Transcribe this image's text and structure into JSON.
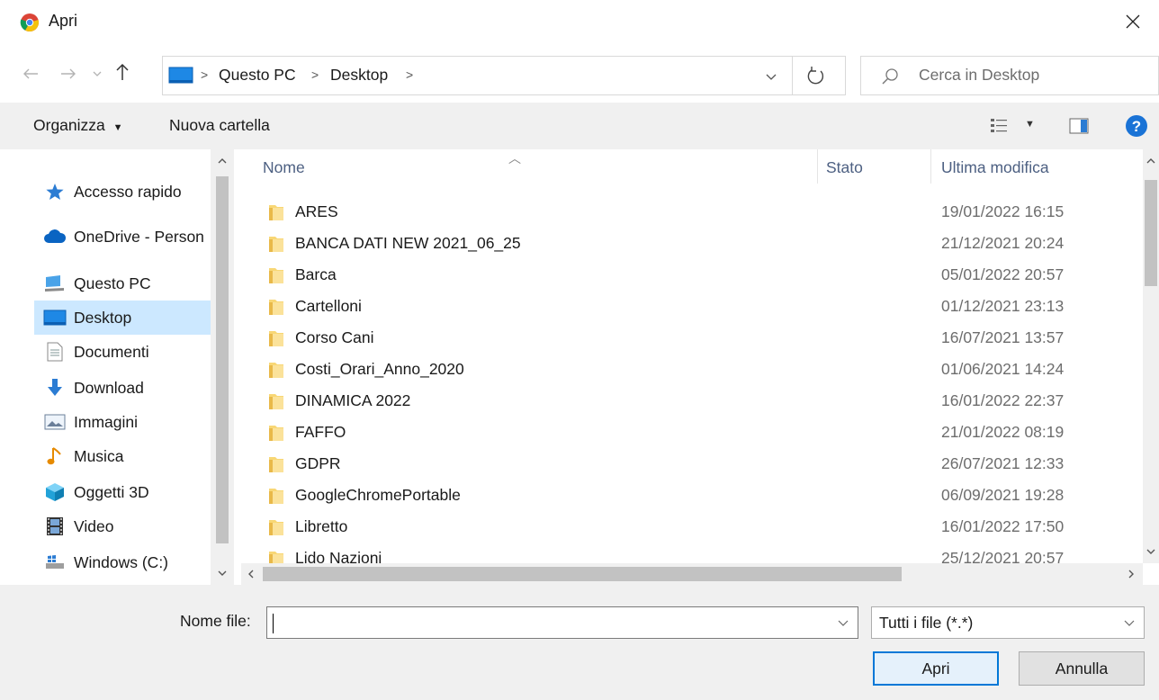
{
  "window": {
    "title": "Apri"
  },
  "breadcrumb": [
    "Questo PC",
    "Desktop"
  ],
  "search": {
    "placeholder": "Cerca in Desktop"
  },
  "toolbar": {
    "organize": "Organizza",
    "new_folder": "Nuova cartella"
  },
  "sidebar": {
    "items": [
      {
        "label": "Accesso rapido",
        "icon": "star-icon"
      },
      {
        "label": "OneDrive - Person",
        "icon": "cloud-icon"
      },
      {
        "label": "Questo PC",
        "icon": "computer-icon"
      },
      {
        "label": "Desktop",
        "icon": "desktop-icon",
        "selected": true
      },
      {
        "label": "Documenti",
        "icon": "document-icon"
      },
      {
        "label": "Download",
        "icon": "download-icon"
      },
      {
        "label": "Immagini",
        "icon": "image-icon"
      },
      {
        "label": "Musica",
        "icon": "music-icon"
      },
      {
        "label": "Oggetti 3D",
        "icon": "cube-icon"
      },
      {
        "label": "Video",
        "icon": "video-icon"
      },
      {
        "label": "Windows  (C:)",
        "icon": "drive-icon"
      }
    ]
  },
  "columns": {
    "name": "Nome",
    "status": "Stato",
    "modified": "Ultima modifica"
  },
  "files": [
    {
      "name": "ARES",
      "modified": "19/01/2022 16:15"
    },
    {
      "name": "BANCA DATI NEW 2021_06_25",
      "modified": "21/12/2021 20:24"
    },
    {
      "name": "Barca",
      "modified": "05/01/2022 20:57"
    },
    {
      "name": "Cartelloni",
      "modified": "01/12/2021 23:13"
    },
    {
      "name": "Corso Cani",
      "modified": "16/07/2021 13:57"
    },
    {
      "name": "Costi_Orari_Anno_2020",
      "modified": "01/06/2021 14:24"
    },
    {
      "name": "DINAMICA 2022",
      "modified": "16/01/2022 22:37"
    },
    {
      "name": "FAFFO",
      "modified": "21/01/2022 08:19"
    },
    {
      "name": "GDPR",
      "modified": "26/07/2021 12:33"
    },
    {
      "name": "GoogleChromePortable",
      "modified": "06/09/2021 19:28"
    },
    {
      "name": "Libretto",
      "modified": "16/01/2022 17:50"
    },
    {
      "name": "Lido Nazioni",
      "modified": "25/12/2021 20:57"
    }
  ],
  "footer": {
    "filename_label": "Nome file:",
    "filename_value": "",
    "filetype": "Tutti i file (*.*)",
    "open": "Apri",
    "cancel": "Annulla"
  },
  "colors": {
    "selection": "#cce8ff",
    "accent": "#0078d7",
    "folder": "#f8d775",
    "help": "#1a73d6"
  }
}
